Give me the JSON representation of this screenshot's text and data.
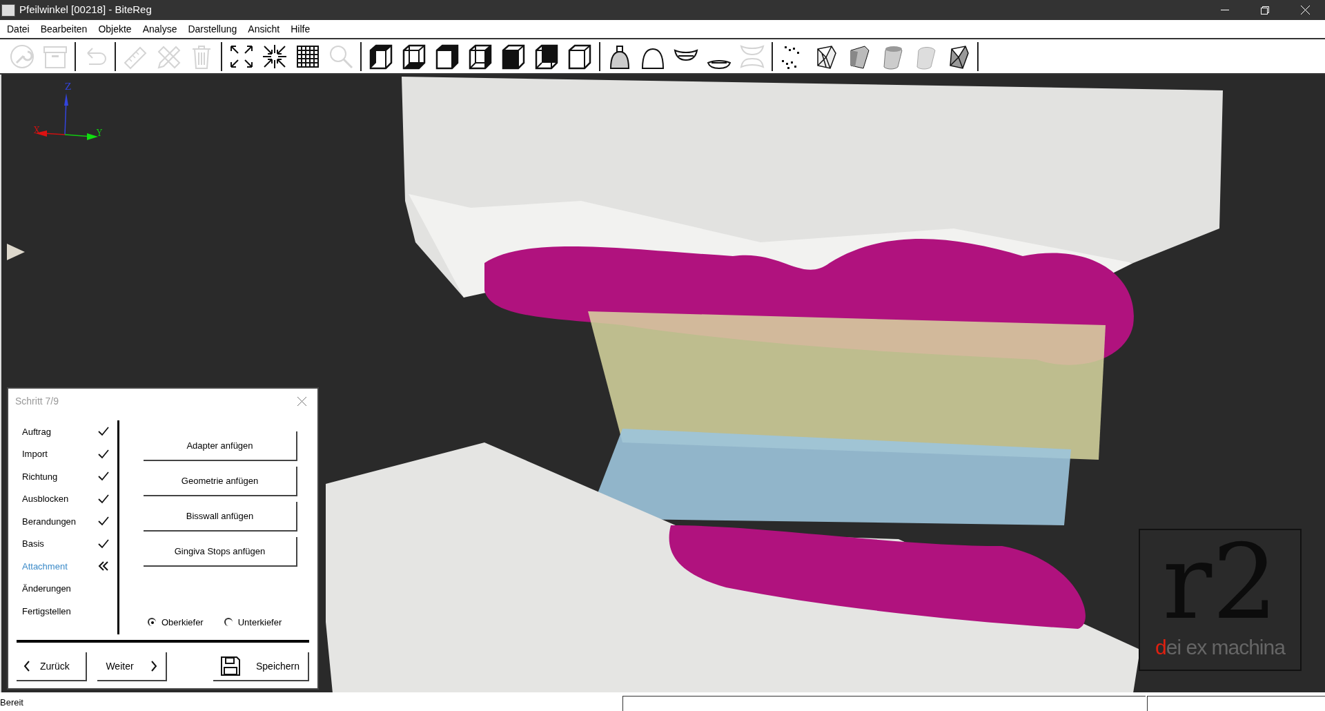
{
  "window": {
    "title": "Pfeilwinkel [00218] - BiteReg"
  },
  "menu": [
    "Datei",
    "Bearbeiten",
    "Objekte",
    "Analyse",
    "Darstellung",
    "Ansicht",
    "Hilfe"
  ],
  "toolbar": [
    [
      {
        "kind": "wrench",
        "disabled": true
      },
      {
        "kind": "archive",
        "disabled": true
      }
    ],
    [
      {
        "kind": "undo",
        "disabled": true
      }
    ],
    [
      {
        "kind": "ruler",
        "disabled": true
      },
      {
        "kind": "tools",
        "disabled": true
      },
      {
        "kind": "trash",
        "disabled": true
      }
    ],
    [
      {
        "kind": "expand",
        "disabled": false
      },
      {
        "kind": "compress",
        "disabled": false
      },
      {
        "kind": "grid",
        "disabled": false
      },
      {
        "kind": "search",
        "disabled": true
      }
    ],
    [
      {
        "kind": "cubeleft",
        "disabled": false
      },
      {
        "kind": "cubebottom",
        "disabled": false
      },
      {
        "kind": "cuberight",
        "disabled": false
      },
      {
        "kind": "cubewire",
        "disabled": false
      },
      {
        "kind": "cubefront",
        "disabled": false
      },
      {
        "kind": "cubeback",
        "disabled": false
      },
      {
        "kind": "cubeplain",
        "disabled": false
      }
    ],
    [
      {
        "kind": "dotted",
        "disabled": false
      },
      {
        "kind": "arch",
        "disabled": false
      },
      {
        "kind": "upper",
        "disabled": false
      },
      {
        "kind": "lower",
        "disabled": false
      },
      {
        "kind": "both",
        "disabled": true
      }
    ],
    [
      {
        "kind": "points",
        "disabled": false
      },
      {
        "kind": "mesh",
        "disabled": false
      },
      {
        "kind": "flat",
        "disabled": false
      },
      {
        "kind": "smooth",
        "disabled": false
      },
      {
        "kind": "soft",
        "disabled": false
      },
      {
        "kind": "shaded",
        "disabled": false
      }
    ]
  ],
  "axes": {
    "z": "Z",
    "x": "X",
    "y": "Y"
  },
  "wizard": {
    "title": "Schritt 7/9",
    "steps": [
      {
        "label": "Auftrag",
        "done": true,
        "selected": false
      },
      {
        "label": "Import",
        "done": true,
        "selected": false
      },
      {
        "label": "Richtung",
        "done": true,
        "selected": false
      },
      {
        "label": "Ausblocken",
        "done": true,
        "selected": false
      },
      {
        "label": "Berandungen",
        "done": true,
        "selected": false
      },
      {
        "label": "Basis",
        "done": true,
        "selected": false
      },
      {
        "label": "Attachment",
        "done": false,
        "selected": true
      },
      {
        "label": "Änderungen",
        "done": false,
        "selected": false
      },
      {
        "label": "Fertigstellen",
        "done": false,
        "selected": false
      }
    ],
    "actions": [
      "Adapter anfügen",
      "Geometrie anfügen",
      "Bisswall anfügen",
      "Gingiva Stops anfügen"
    ],
    "jaw_options": [
      {
        "label": "Oberkiefer",
        "selected": true
      },
      {
        "label": "Unterkiefer",
        "selected": false
      }
    ],
    "back": "Zurück",
    "next": "Weiter",
    "save": "Speichern"
  },
  "logo": {
    "mark": "r2",
    "tagline": "dei ex machina"
  },
  "status_bar": {
    "message": "Bereit"
  }
}
